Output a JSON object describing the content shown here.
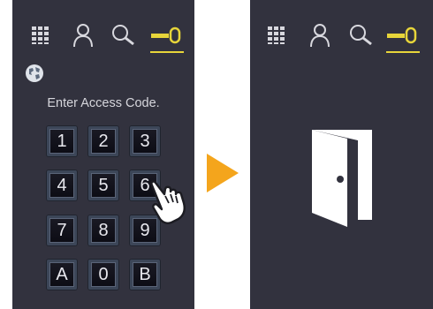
{
  "left_screen": {
    "toolbar": {
      "icons": [
        "grid-icon",
        "person-icon",
        "search-icon",
        "key-icon"
      ],
      "active": "key-icon",
      "accent_color": "#e7d53a"
    },
    "globe_icon": "globe-icon",
    "prompt": "Enter Access Code.",
    "keys": [
      "1",
      "2",
      "3",
      "4",
      "5",
      "6",
      "7",
      "8",
      "9",
      "A",
      "0",
      "B"
    ],
    "pressed_key": "6"
  },
  "transition_arrow": {
    "color": "#f4a51c"
  },
  "right_screen": {
    "toolbar": {
      "icons": [
        "grid-icon",
        "person-icon",
        "search-icon",
        "key-icon"
      ],
      "active": "key-icon"
    },
    "main_icon": "open-door-icon"
  },
  "colors": {
    "panel_bg": "#32323e",
    "text": "#d6d6dc"
  }
}
